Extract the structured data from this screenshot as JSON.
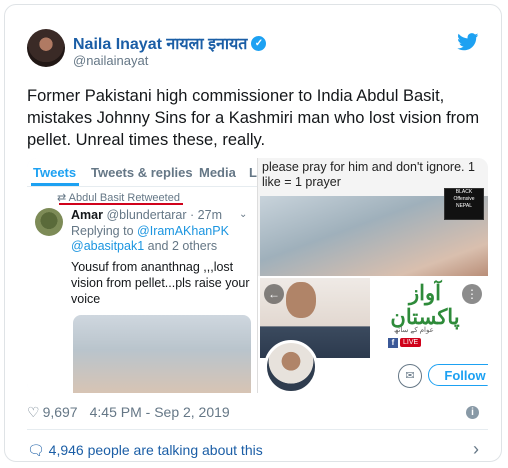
{
  "author": {
    "name": "Naila Inayat नायला इनायत",
    "handle": "@nailainayat",
    "verified_icon": "check-icon"
  },
  "tweet": {
    "text": "Former Pakistani high commissioner to India Abdul Basit, mistakes Johnny Sins for a Kashmiri man who lost vision from pellet. Unreal times these, really."
  },
  "embedded_screenshot": {
    "tabs": [
      "Tweets",
      "Tweets & replies",
      "Media",
      "L"
    ],
    "retweet_line": "Abdul Basit Retweeted",
    "retweeter_name": "Amar",
    "retweeter_handle": "@blundertarar",
    "retweeter_age": "· 27m",
    "replying_prefix": "Replying to",
    "replying_mention_1": "@IramAKhanPK",
    "replying_mention_2": "@abasitpak1",
    "replying_suffix": "and 2 others",
    "body": "Yousuf from ananthnag ,,,lost vision from pellet...pls raise your voice"
  },
  "pray_panel": {
    "text": "please pray for him and don't ignore. 1 like = 1 prayer",
    "badge_lines": [
      "BLACK",
      "Offensive",
      "NEPAL"
    ]
  },
  "profile_panel": {
    "logo_text": "آواز پاکستان",
    "logo_sub": "عوام کے ساتھ",
    "live_label": "LIVE",
    "fb_label": "f",
    "follow_label": "Follow"
  },
  "meta": {
    "likes": "9,697",
    "time": "4:45 PM - Sep 2, 2019"
  },
  "footer": {
    "talking": "4,946 people are talking about this"
  },
  "colors": {
    "link": "#1b5ea6",
    "twitter_blue": "#1da1f2",
    "muted": "#657786"
  }
}
